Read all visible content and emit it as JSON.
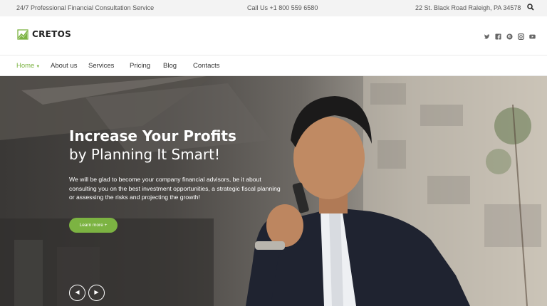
{
  "topbar": {
    "tagline": "24/7 Professional Financial Consultation Service",
    "phone": "Call Us +1 800 559 6580",
    "address": "22 St. Black Road Raleigh, PA 34578",
    "search_icon": "search-icon"
  },
  "header": {
    "logo_text": "CRETOS",
    "logo_icon": "chart-logo-icon",
    "social": [
      "twitter-icon",
      "facebook-icon",
      "pinterest-icon",
      "instagram-icon",
      "youtube-icon"
    ]
  },
  "nav": {
    "items": [
      {
        "label": "Home",
        "active": true
      },
      {
        "label": "About us"
      },
      {
        "label": "Services"
      },
      {
        "label": "Pricing"
      },
      {
        "label": "Blog"
      },
      {
        "label": "Contacts"
      }
    ]
  },
  "hero": {
    "title_line1": "Increase Your Profits",
    "title_line2": "by Planning It Smart!",
    "text": "We will be glad to become your company financial advisors, be it about consulting you on the best investment opportunities, a strategic fiscal planning or assessing the risks and projecting the growth!",
    "button_label": "Learn more +",
    "prev_label": "◀",
    "next_label": "▶"
  },
  "colors": {
    "accent": "#7cb342",
    "text_dark": "#222222",
    "topbar_bg": "#f3f3f3"
  }
}
